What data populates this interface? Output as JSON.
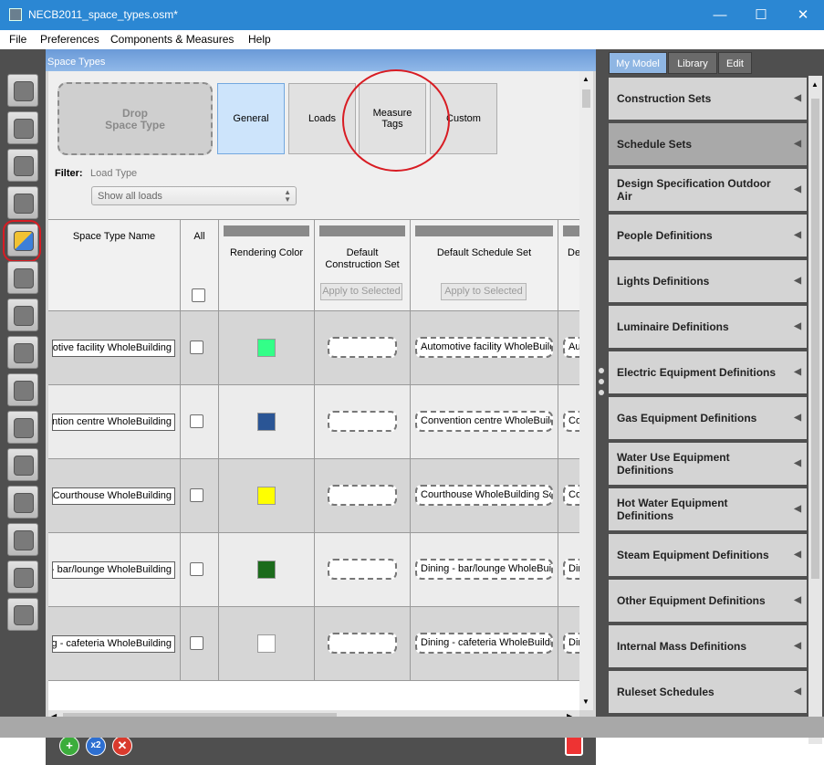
{
  "window": {
    "title": "NECB2011_space_types.osm*",
    "minimize": "—",
    "maximize": "☐",
    "close": "✕"
  },
  "menu": [
    "File",
    "Preferences",
    "Components & Measures",
    "Help"
  ],
  "center_panel": {
    "header": "Space Types",
    "drop_zone": "Drop\nSpace Type",
    "tabs": [
      "General",
      "Loads",
      "Measure\nTags",
      "Custom"
    ],
    "active_tab": "General",
    "filter_label": "Filter:",
    "filter_sublabel": "Load Type",
    "filter_value": "Show all loads",
    "columns": {
      "name": "Space Type Name",
      "all": "All",
      "rendering_color": "Rendering Color",
      "construction_set": "Default\nConstruction Set",
      "schedule_set": "Default Schedule Set",
      "cut_col": "De",
      "apply_label": "Apply to Selected"
    },
    "rows": [
      {
        "name": "Automotive facility WholeBuilding",
        "color": "#33ff88",
        "schedule_set": "Automotive facility WholeBuilding Schedule Set",
        "cut": "Aut"
      },
      {
        "name": "Convention centre WholeBuilding",
        "color": "#2a5595",
        "schedule_set": "Convention centre WholeBuilding Schedule Set",
        "cut": "Con"
      },
      {
        "name": "Courthouse WholeBuilding",
        "color": "#ffff00",
        "schedule_set": "Courthouse WholeBuilding Schedule Set",
        "cut": "Cou"
      },
      {
        "name": "Dining - bar/lounge WholeBuilding",
        "color": "#1c6b1c",
        "schedule_set": "Dining - bar/lounge WholeBuilding Schedule Set",
        "cut": "Din"
      },
      {
        "name": "Dining - cafeteria WholeBuilding",
        "color": "#ffffff",
        "schedule_set": "Dining - cafeteria WholeBuilding Schedule Set",
        "cut": "Din"
      }
    ],
    "bottom_buttons": {
      "add": "+",
      "copy": "x2",
      "delete": "✕"
    }
  },
  "right_panel": {
    "tabs": [
      "My Model",
      "Library",
      "Edit"
    ],
    "active_tab": "My Model",
    "items": [
      "Construction Sets",
      "Schedule Sets",
      "Design Specification Outdoor Air",
      "People Definitions",
      "Lights Definitions",
      "Luminaire Definitions",
      "Electric Equipment Definitions",
      "Gas Equipment Definitions",
      "Water Use Equipment Definitions",
      "Hot Water Equipment Definitions",
      "Steam Equipment Definitions",
      "Other Equipment Definitions",
      "Internal Mass Definitions",
      "Ruleset Schedules"
    ],
    "highlighted_item": "Schedule Sets"
  },
  "left_nav": [
    "site-icon",
    "schedules-icon",
    "constructions-icon",
    "loads-icon",
    "space-types-icon",
    "geometry-icon",
    "facility-icon",
    "spaces-icon",
    "thermal-zones-icon",
    "hvac-icon",
    "variables-icon",
    "simulation-settings-icon",
    "scripts-icon",
    "run-icon",
    "results-icon"
  ],
  "selected_nav": "space-types-icon"
}
